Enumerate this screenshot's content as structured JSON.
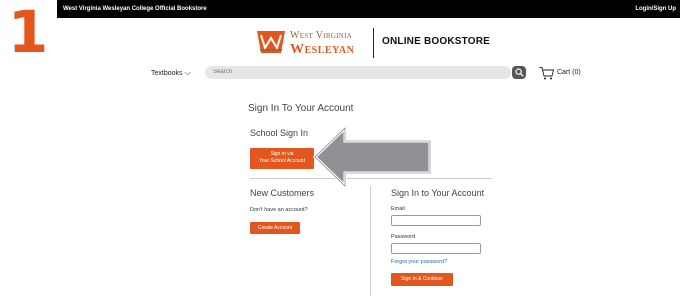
{
  "step_number": "1",
  "topbar": {
    "site_name": "West Virginia Wesleyan College Official Bookstore",
    "login_label": "Login/Sign Up"
  },
  "logo": {
    "line1": "West Virginia",
    "line2": "Wesleyan"
  },
  "store_title": "ONLINE BOOKSTORE",
  "nav": {
    "textbooks_label": "Textbooks",
    "search_placeholder": "Search",
    "cart_label": "Cart (0)"
  },
  "signin": {
    "heading": "Sign In To Your Account",
    "school_heading": "School Sign In",
    "school_button_line1": "Sign in via",
    "school_button_line2": "Your School Account"
  },
  "new_customers": {
    "heading": "New Customers",
    "text": "Don't have an account?",
    "button": "Create Account"
  },
  "account_signin": {
    "heading": "Sign In to Your Account",
    "email_label": "Email",
    "password_label": "Password",
    "forgot_link": "Forgot your password?",
    "button": "Sign In & Continue"
  },
  "colors": {
    "accent": "#e3571f",
    "arrow": "#8f9194",
    "topbar": "#000000"
  }
}
